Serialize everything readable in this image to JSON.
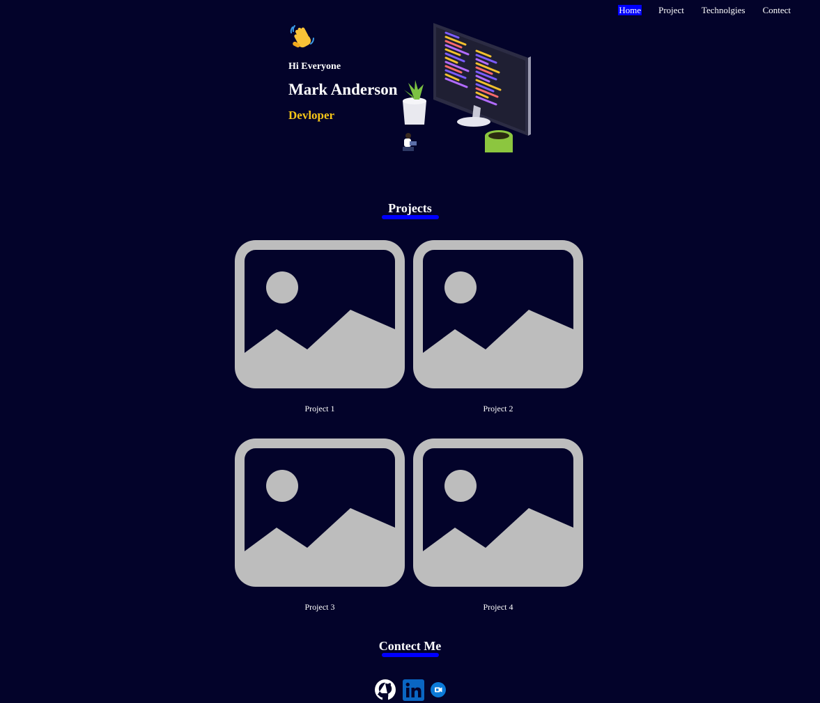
{
  "nav": {
    "items": [
      {
        "label": "Home",
        "active": true
      },
      {
        "label": "Project",
        "active": false
      },
      {
        "label": "Technolgies",
        "active": false
      },
      {
        "label": "Contect",
        "active": false
      }
    ]
  },
  "hero": {
    "greeting": "Hi Everyone",
    "name": "Mark Anderson",
    "role": "Devloper",
    "wave_icon": "waving-hand-icon",
    "illustration": "developer-desk-illustration"
  },
  "projects": {
    "title": "Projects",
    "items": [
      {
        "caption": "Project 1",
        "icon": "image-placeholder-icon"
      },
      {
        "caption": "Project 2",
        "icon": "image-placeholder-icon"
      },
      {
        "caption": "Project 3",
        "icon": "image-placeholder-icon"
      },
      {
        "caption": "Project 4",
        "icon": "image-placeholder-icon"
      }
    ]
  },
  "contact": {
    "title": "Contect Me",
    "links": [
      "github-icon",
      "linkedin-icon",
      "email-icon"
    ]
  },
  "colors": {
    "background": "#03032a",
    "accent": "#0000ff",
    "role": "#f5c518",
    "placeholder": "#bdbdbd"
  }
}
